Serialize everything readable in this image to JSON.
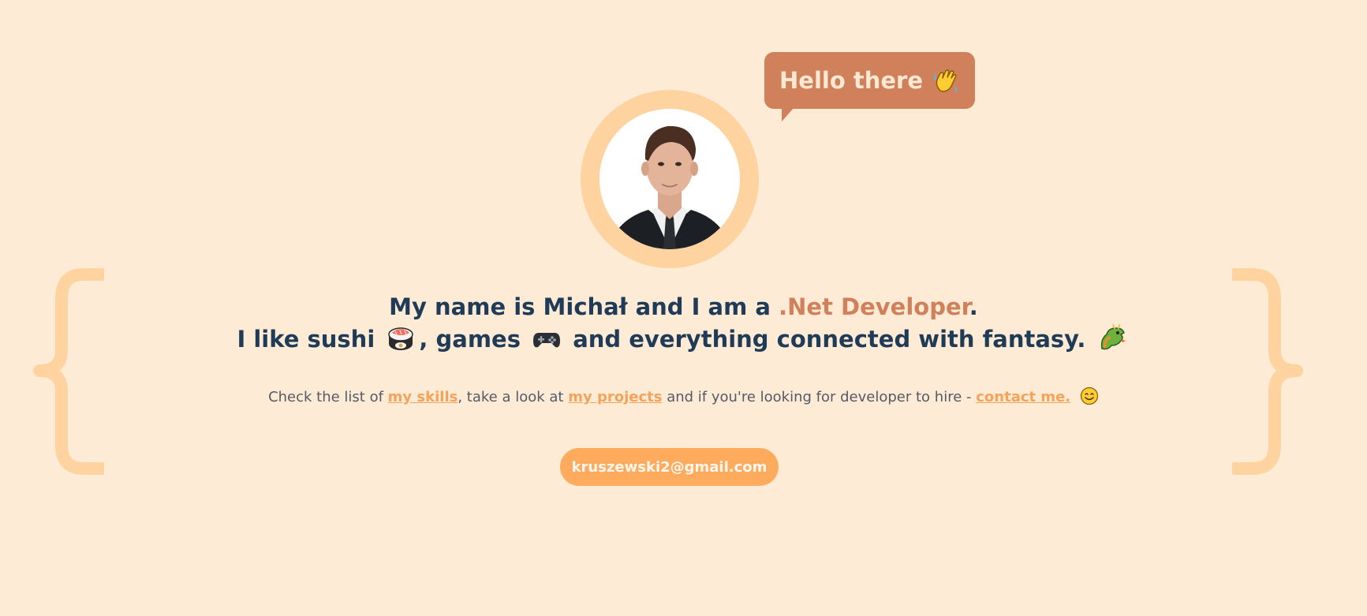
{
  "bubble": {
    "text": "Hello there",
    "icon": "waving-hand-icon"
  },
  "avatar": {
    "description_icon": "profile-photo"
  },
  "intro": {
    "line1_prefix": "My name is Michał and I am a",
    "line1_accent": ".Net Developer",
    "line1_suffix": ".",
    "line2_part1": "I like sushi",
    "line2_part2": ", games",
    "line2_part3": "and everything connected with fantasy.",
    "icons": [
      "sushi-icon",
      "gamepad-icon",
      "dragon-icon"
    ]
  },
  "sub": {
    "part1": "Check the list of",
    "link_skills": "my skills",
    "part2": ", take a look at",
    "link_projects": "my projects",
    "part3": "and if you're looking for developer to hire -",
    "link_contact": "contact me.",
    "icon": "smiling-face-icon"
  },
  "email_button": {
    "label": "kruszewski2@gmail.com"
  },
  "colors": {
    "background": "#feebd5",
    "accent": "#d0805b",
    "link": "#f5a35a",
    "button": "#ffab5e",
    "brace": "#ffd39f",
    "heading": "#1f3b57"
  }
}
